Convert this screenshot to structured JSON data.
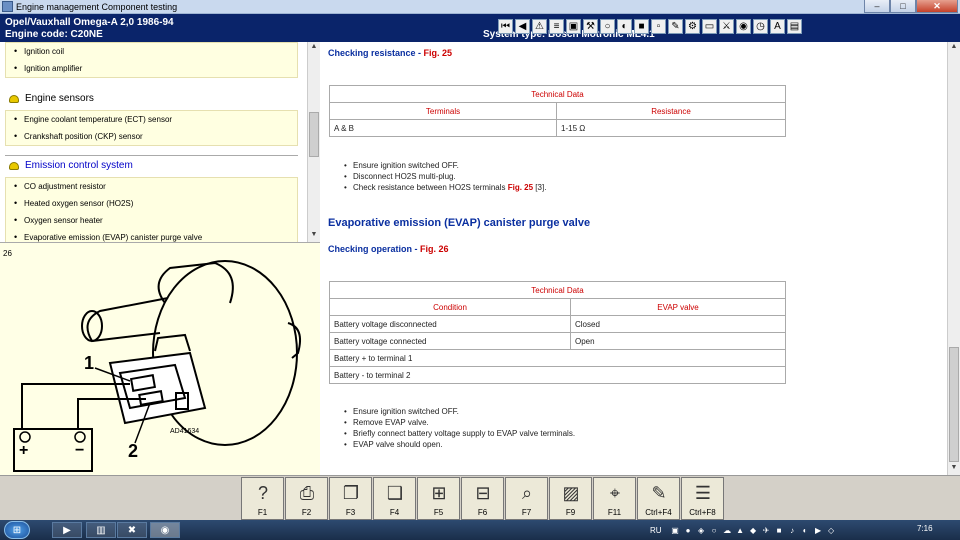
{
  "window": {
    "title": "Engine management Component testing",
    "buttons": [
      "–",
      "□",
      "✕"
    ]
  },
  "header": {
    "vehicle": "Opel/Vauxhall   Omega-A  2,0  1986-94",
    "engine_code": "Engine code: C20NE",
    "system_type": "System type: Bosch Motronic ML4.1",
    "toolbar_icons": [
      "first-icon",
      "prev-icon",
      "warning-icon",
      "chart-icon",
      "image-icon",
      "tools-icon",
      "wheel-icon",
      "gauge-icon",
      "car-icon",
      "door-icon",
      "brush-icon",
      "settings-icon",
      "battery-icon",
      "engine-icon",
      "bulb-icon",
      "clock-icon",
      "text-icon",
      "page-icon"
    ],
    "toolbar_glyphs": [
      "⏮",
      "◀",
      "⚠",
      "≡",
      "▣",
      "⚒",
      "○",
      "◐",
      "■",
      "▫",
      "✎",
      "⚙",
      "▭",
      "⚔",
      "◉",
      "◷",
      "A",
      "▤"
    ]
  },
  "nav": {
    "group1_items": [
      "Ignition coil",
      "Ignition amplifier"
    ],
    "sensors_heading": "Engine sensors",
    "sensors_items": [
      "Engine coolant temperature (ECT) sensor",
      "Crankshaft position (CKP) sensor"
    ],
    "emission_heading": "Emission control system",
    "emission_items": [
      "CO adjustment resistor",
      "Heated oxygen sensor (HO2S)",
      "Oxygen sensor heater",
      "Evaporative emission (EVAP) canister purge valve"
    ]
  },
  "figure": {
    "number": "26",
    "label_1": "1",
    "label_2": "2",
    "code": "AD41634",
    "plus": "+",
    "minus": "−"
  },
  "content": {
    "section1": {
      "subheading": "Checking resistance - ",
      "fig_ref": "Fig. 25",
      "table_caption": "Technical Data",
      "col_terminals": "Terminals",
      "col_resistance": "Resistance",
      "rows": [
        [
          "A & B",
          "1-15 Ω"
        ]
      ],
      "steps": [
        "Ensure ignition switched OFF.",
        "Disconnect HO2S multi-plug."
      ],
      "step3_text": "Check resistance between HO2S terminals ",
      "step3_fig": "Fig. 25",
      "step3_tail": " [3]."
    },
    "section2": {
      "heading": "Evaporative emission (EVAP) canister purge valve",
      "subheading": "Checking operation - ",
      "fig_ref": "Fig. 26",
      "table_caption": "Technical Data",
      "col_condition": "Condition",
      "col_evap": "EVAP valve",
      "rows": [
        [
          "Battery voltage disconnected",
          "Closed"
        ],
        [
          "Battery voltage connected",
          "Open"
        ],
        [
          "Battery + to terminal 1",
          ""
        ],
        [
          "Battery - to terminal 2",
          ""
        ]
      ],
      "steps": [
        "Ensure ignition switched OFF.",
        "Remove EVAP valve.",
        "Briefly connect battery voltage supply to EVAP valve terminals.",
        "EVAP valve should open."
      ]
    }
  },
  "fkeys": [
    {
      "label": "F1",
      "icon": "help-icon",
      "glyph": "?"
    },
    {
      "label": "F2",
      "icon": "print-icon",
      "glyph": "⎙"
    },
    {
      "label": "F3",
      "icon": "copy-icon",
      "glyph": "❐"
    },
    {
      "label": "F4",
      "icon": "paste-icon",
      "glyph": "❑"
    },
    {
      "label": "F5",
      "icon": "connector-icon",
      "glyph": "⊞"
    },
    {
      "label": "F6",
      "icon": "pinout-icon",
      "glyph": "⊟"
    },
    {
      "label": "F7",
      "icon": "zoom-icon",
      "glyph": "⌕"
    },
    {
      "label": "F9",
      "icon": "component-icon",
      "glyph": "▨"
    },
    {
      "label": "F11",
      "icon": "wiring-icon",
      "glyph": "⌖"
    },
    {
      "label": "Ctrl+F4",
      "icon": "notepad-icon",
      "glyph": "✎"
    },
    {
      "label": "Ctrl+F8",
      "icon": "list-icon",
      "glyph": "☰"
    }
  ],
  "taskbar": {
    "start_glyph": "⊞",
    "apps": [
      {
        "name": "media-player-icon",
        "glyph": "▶"
      },
      {
        "name": "explorer-icon",
        "glyph": "▥"
      },
      {
        "name": "app-icon",
        "glyph": "✖"
      },
      {
        "name": "autodata-icon",
        "glyph": "◉"
      }
    ],
    "language": "RU",
    "tray_glyphs": [
      "▣",
      "●",
      "◈",
      "○",
      "☁",
      "▲",
      "◆",
      "✈",
      "■",
      "♪",
      "◐",
      "▶",
      "◇"
    ],
    "clock": "7:16"
  }
}
